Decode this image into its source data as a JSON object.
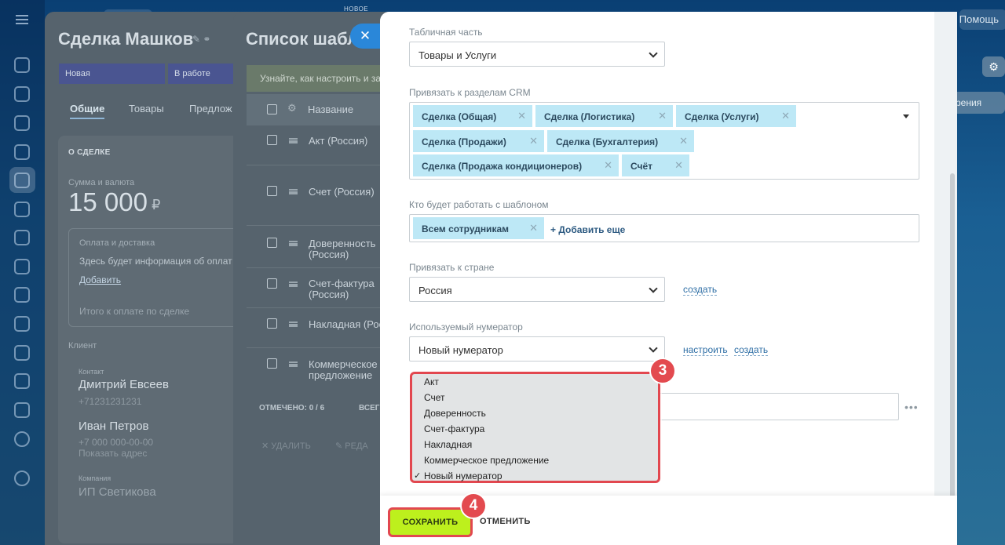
{
  "topbar": {
    "help": "Помощь",
    "new_label": "НОВОЕ"
  },
  "deal": {
    "title": "Сделка Машков",
    "stage_new": "Новая",
    "stage_in_work": "В работе",
    "tabs": [
      "Общие",
      "Товары",
      "Предлож"
    ],
    "section_title": "О СДЕЛКЕ",
    "amount_label": "Сумма и валюта",
    "amount": "15 000",
    "currency": "₽",
    "payment_label": "Оплата и доставка",
    "payment_text": "Здесь будет информация об оплат",
    "add_link": "Добавить",
    "total_label": "Итого к оплате по сделке",
    "client_label": "Клиент",
    "contact_label": "Контакт",
    "contact1": "Дмитрий Евсеев",
    "contact1_phone": "+71231231231",
    "contact2": "Иван Петров",
    "contact2_phone": "+7 000 000-00-00",
    "show_address": "Показать адрес",
    "company_label": "Компания",
    "company": "ИП Светикова"
  },
  "templates": {
    "title": "Список шабл",
    "info": "Узнайте, как настроить и за",
    "col_name": "Название",
    "rows": [
      {
        "name": "Акт (Россия)"
      },
      {
        "name": "Счет (Россия)"
      },
      {
        "name": "Доверенность (Россия)"
      },
      {
        "name": "Счет-фактура (Россия)"
      },
      {
        "name": "Накладная (Рос"
      },
      {
        "name": "Коммерческое предложение"
      }
    ],
    "selected": "ОТМЕЧЕНО: 0 / 6",
    "all": "ВСЕГ",
    "delete": "УДАЛИТЬ",
    "edit": "РЕДА"
  },
  "right": {
    "tab": "рения"
  },
  "form": {
    "table_part_label": "Табличная часть",
    "table_part_value": "Товары и Услуги",
    "crm_label": "Привязать к разделам CRM",
    "crm_chips": [
      "Сделка (Общая)",
      "Сделка (Логистика)",
      "Сделка (Услуги)",
      "Сделка (Продажи)",
      "Сделка (Бухгалтерия)",
      "Сделка (Продажа кондиционеров)",
      "Счёт"
    ],
    "who_label": "Кто будет работать с шаблоном",
    "who_chip": "Всем сотрудникам",
    "add_more": "+ Добавить еще",
    "country_label": "Привязать к стране",
    "country_value": "Россия",
    "create_link": "создать",
    "numerator_label": "Используемый нумератор",
    "numerator_value": "Новый нумератор",
    "configure_link": "настроить",
    "create_link2": "создать",
    "dropdown_options": [
      "Акт",
      "Счет",
      "Доверенность",
      "Счет-фактура",
      "Накладная",
      "Коммерческое предложение",
      "Новый нумератор"
    ],
    "dropdown_selected": "Новый нумератор",
    "check_mark": "✓",
    "dots": "•••"
  },
  "badges": {
    "step3": "3",
    "step4": "4"
  },
  "footer": {
    "save": "СОХРАНИТЬ",
    "cancel": "ОТМЕНИТЬ"
  },
  "colors": {
    "accent_save": "#bdf01d",
    "highlight_red": "#e2474f",
    "chip_bg": "#bde8f6",
    "close_blue": "#2a87d9"
  }
}
